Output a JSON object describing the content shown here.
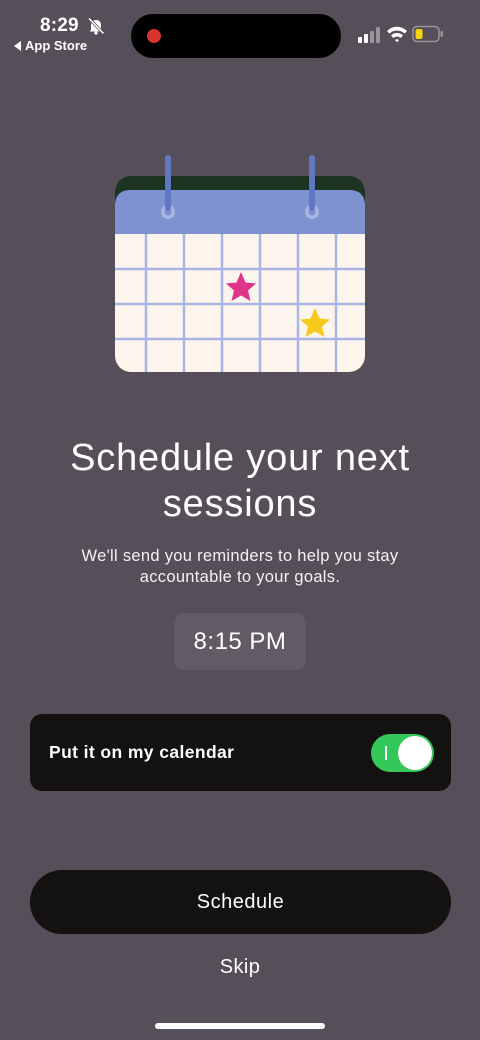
{
  "status_bar": {
    "time": "8:29",
    "back_app_label": "App Store",
    "icons": [
      "bell-slash-icon",
      "cellular-signal-icon",
      "wifi-icon",
      "battery-icon"
    ],
    "recording_color": "#d6342c"
  },
  "illustration": {
    "name": "calendar-illustration",
    "stars": [
      "pink-star-icon",
      "yellow-star-icon"
    ],
    "colors": {
      "header": "#7e92d1",
      "grid": "#fdf4ec",
      "rings": "#5f78c4",
      "pink_star": "#e0338a",
      "yellow_star": "#f7c91c"
    }
  },
  "main": {
    "title": "Schedule your next sessions",
    "subtitle": "We'll send you reminders to help you stay accountable to your goals.",
    "time_value": "8:15 PM"
  },
  "calendar_toggle": {
    "label": "Put it on my calendar",
    "enabled": true,
    "on_color": "#34c759"
  },
  "actions": {
    "schedule_label": "Schedule",
    "skip_label": "Skip"
  },
  "theme": {
    "background": "#564e58",
    "card": "#141210"
  }
}
